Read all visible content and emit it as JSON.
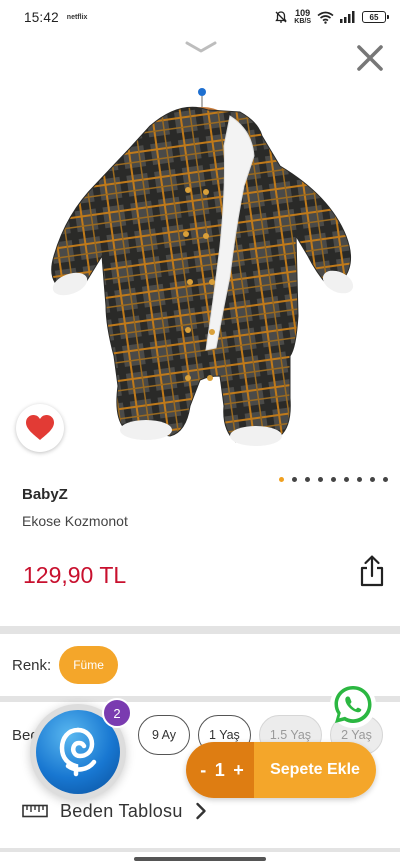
{
  "status_bar": {
    "time": "15:42",
    "app_icon_text": "netflix",
    "speed_value": "109",
    "speed_unit": "KB/S",
    "battery": "65"
  },
  "product": {
    "brand": "BabyZ",
    "name": "Ekose Kozmonot",
    "price": "129,90 TL",
    "image_icon": "plaid-jumpsuit-image",
    "gallery_pages": 9,
    "gallery_active": 1
  },
  "options": {
    "color_label": "Renk:",
    "color_selected": "Füme",
    "size_label": "Beden:",
    "sizes": [
      {
        "label": "9 Ay",
        "available": true
      },
      {
        "label": "1 Yaş",
        "available": true
      },
      {
        "label": "1.5 Yaş",
        "available": false
      },
      {
        "label": "2 Yaş",
        "available": false
      }
    ],
    "size_table_label": "Beden Tablosu"
  },
  "cart": {
    "minus": "-",
    "quantity": "1",
    "plus": "+",
    "add_label": "Sepete Ekle"
  },
  "assistant": {
    "badge_count": "2"
  },
  "colors": {
    "accent_orange": "#f4a62a",
    "stepper_orange": "#de7d12",
    "price_red": "#c8102e",
    "heart_red": "#e23b35",
    "whatsapp_green": "#2bb741",
    "badge_purple": "#7a3bb0",
    "assistant_blue": "#1877d1"
  }
}
